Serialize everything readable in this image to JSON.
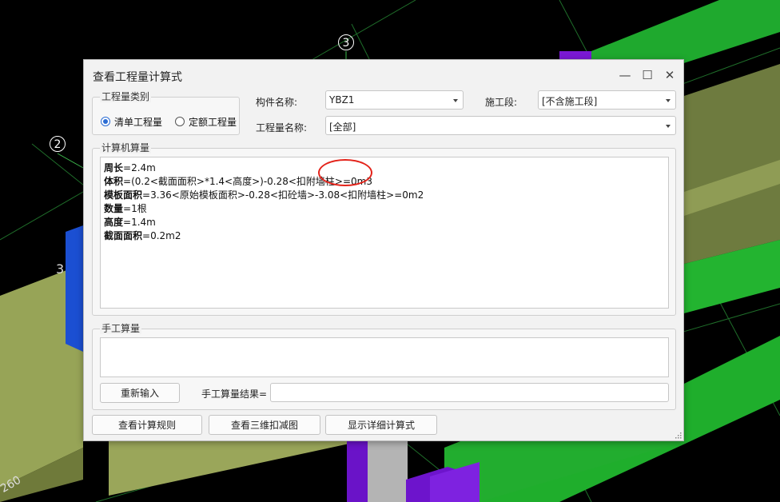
{
  "scene": {
    "axis_labels": [
      "3",
      "2"
    ],
    "partial_labels": [
      "3",
      "260"
    ]
  },
  "dialog": {
    "title": "查看工程量计算式",
    "window_controls": {
      "minimize": "—",
      "maximize": "☐",
      "close": "✕"
    },
    "quantity_type": {
      "label": "工程量类别",
      "options": [
        {
          "label": "清单工程量",
          "checked": true
        },
        {
          "label": "定额工程量",
          "checked": false
        }
      ]
    },
    "component_name": {
      "label": "构件名称:",
      "value": "YBZ1"
    },
    "construction_stage": {
      "label": "施工段:",
      "value": "[不含施工段]"
    },
    "quantity_name": {
      "label": "工程量名称:",
      "value": "[全部]"
    },
    "computer_calc": {
      "label": "计算机算量",
      "lines": [
        {
          "name": "周长",
          "expr": "=2.4m"
        },
        {
          "name": "体积",
          "expr": "=(0.2<截面面积>*1.4<高度>)-0.28<扣附墙柱>=0m3"
        },
        {
          "name": "模板面积",
          "expr": "=3.36<原始模板面积>-0.28<扣砼墙>-3.08<扣附墙柱>=0m2"
        },
        {
          "name": "数量",
          "expr": "=1根"
        },
        {
          "name": "高度",
          "expr": "=1.4m"
        },
        {
          "name": "截面面积",
          "expr": "=0.2m2"
        }
      ]
    },
    "manual_calc": {
      "label": "手工算量",
      "reenter_button": "重新输入",
      "result_label": "手工算量结果=",
      "result_value": ""
    },
    "buttons": {
      "view_rules": "查看计算规则",
      "view_3d": "查看三维扣减图",
      "show_detail": "显示详细计算式"
    }
  }
}
